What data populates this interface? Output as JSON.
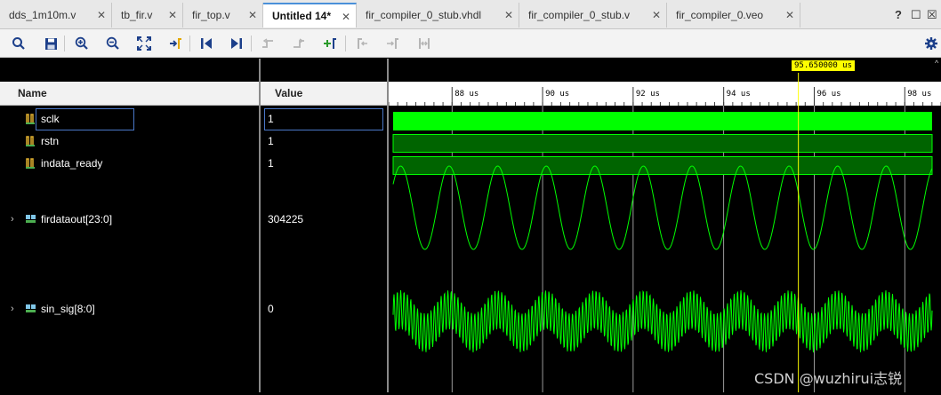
{
  "tabs": [
    {
      "label": "dds_1m10m.v",
      "active": false
    },
    {
      "label": "tb_fir.v",
      "active": false
    },
    {
      "label": "fir_top.v",
      "active": false
    },
    {
      "label": "Untitled 14*",
      "active": true
    },
    {
      "label": "fir_compiler_0_stub.vhdl",
      "active": false
    },
    {
      "label": "fir_compiler_0_stub.v",
      "active": false
    },
    {
      "label": "fir_compiler_0.veo",
      "active": false
    }
  ],
  "tab_close_glyph": "✕",
  "window_controls": {
    "help": "?",
    "restore": "☐",
    "maximize": "☒"
  },
  "toolbar": {
    "icons": [
      "search-icon",
      "save-icon",
      "zoom-in-icon",
      "zoom-out-icon",
      "zoom-fit-icon",
      "go-to-cursor-icon",
      "go-to-time-zero-icon",
      "go-to-last-time-icon",
      "previous-transition-icon",
      "next-transition-icon",
      "add-marker-icon",
      "previous-marker-icon",
      "next-marker-icon",
      "swap-cursors-icon"
    ],
    "settings_icon": "gear-icon"
  },
  "columns": {
    "name": "Name",
    "value": "Value"
  },
  "signals": [
    {
      "name": "sclk",
      "value": "1",
      "kind": "bit",
      "expandable": false
    },
    {
      "name": "rstn",
      "value": "1",
      "kind": "bit",
      "expandable": false
    },
    {
      "name": "indata_ready",
      "value": "1",
      "kind": "bit",
      "expandable": false
    },
    {
      "name": "firdataout[23:0]",
      "value": "304225",
      "kind": "bus",
      "expandable": true
    },
    {
      "name": "sin_sig[8:0]",
      "value": "0",
      "kind": "bus",
      "expandable": true
    }
  ],
  "timeline": {
    "cursor_label": "95.650000 us",
    "cursor_time_us": 95.65,
    "ticks": [
      "88 us",
      "90 us",
      "92 us",
      "94 us",
      "96 us",
      "98 us"
    ],
    "tick_values_us": [
      88,
      90,
      92,
      94,
      96,
      98
    ],
    "visible_range_us": [
      86.6,
      98.8
    ]
  },
  "colors": {
    "clock_fill": "#00ff00",
    "level_fill": "#006400",
    "level_border": "#00ff00",
    "analog_trace": "#00ff00",
    "cursor": "#ffff00",
    "gridline": "#bfbfbf"
  },
  "watermark": "CSDN @wuzhirui志锐"
}
